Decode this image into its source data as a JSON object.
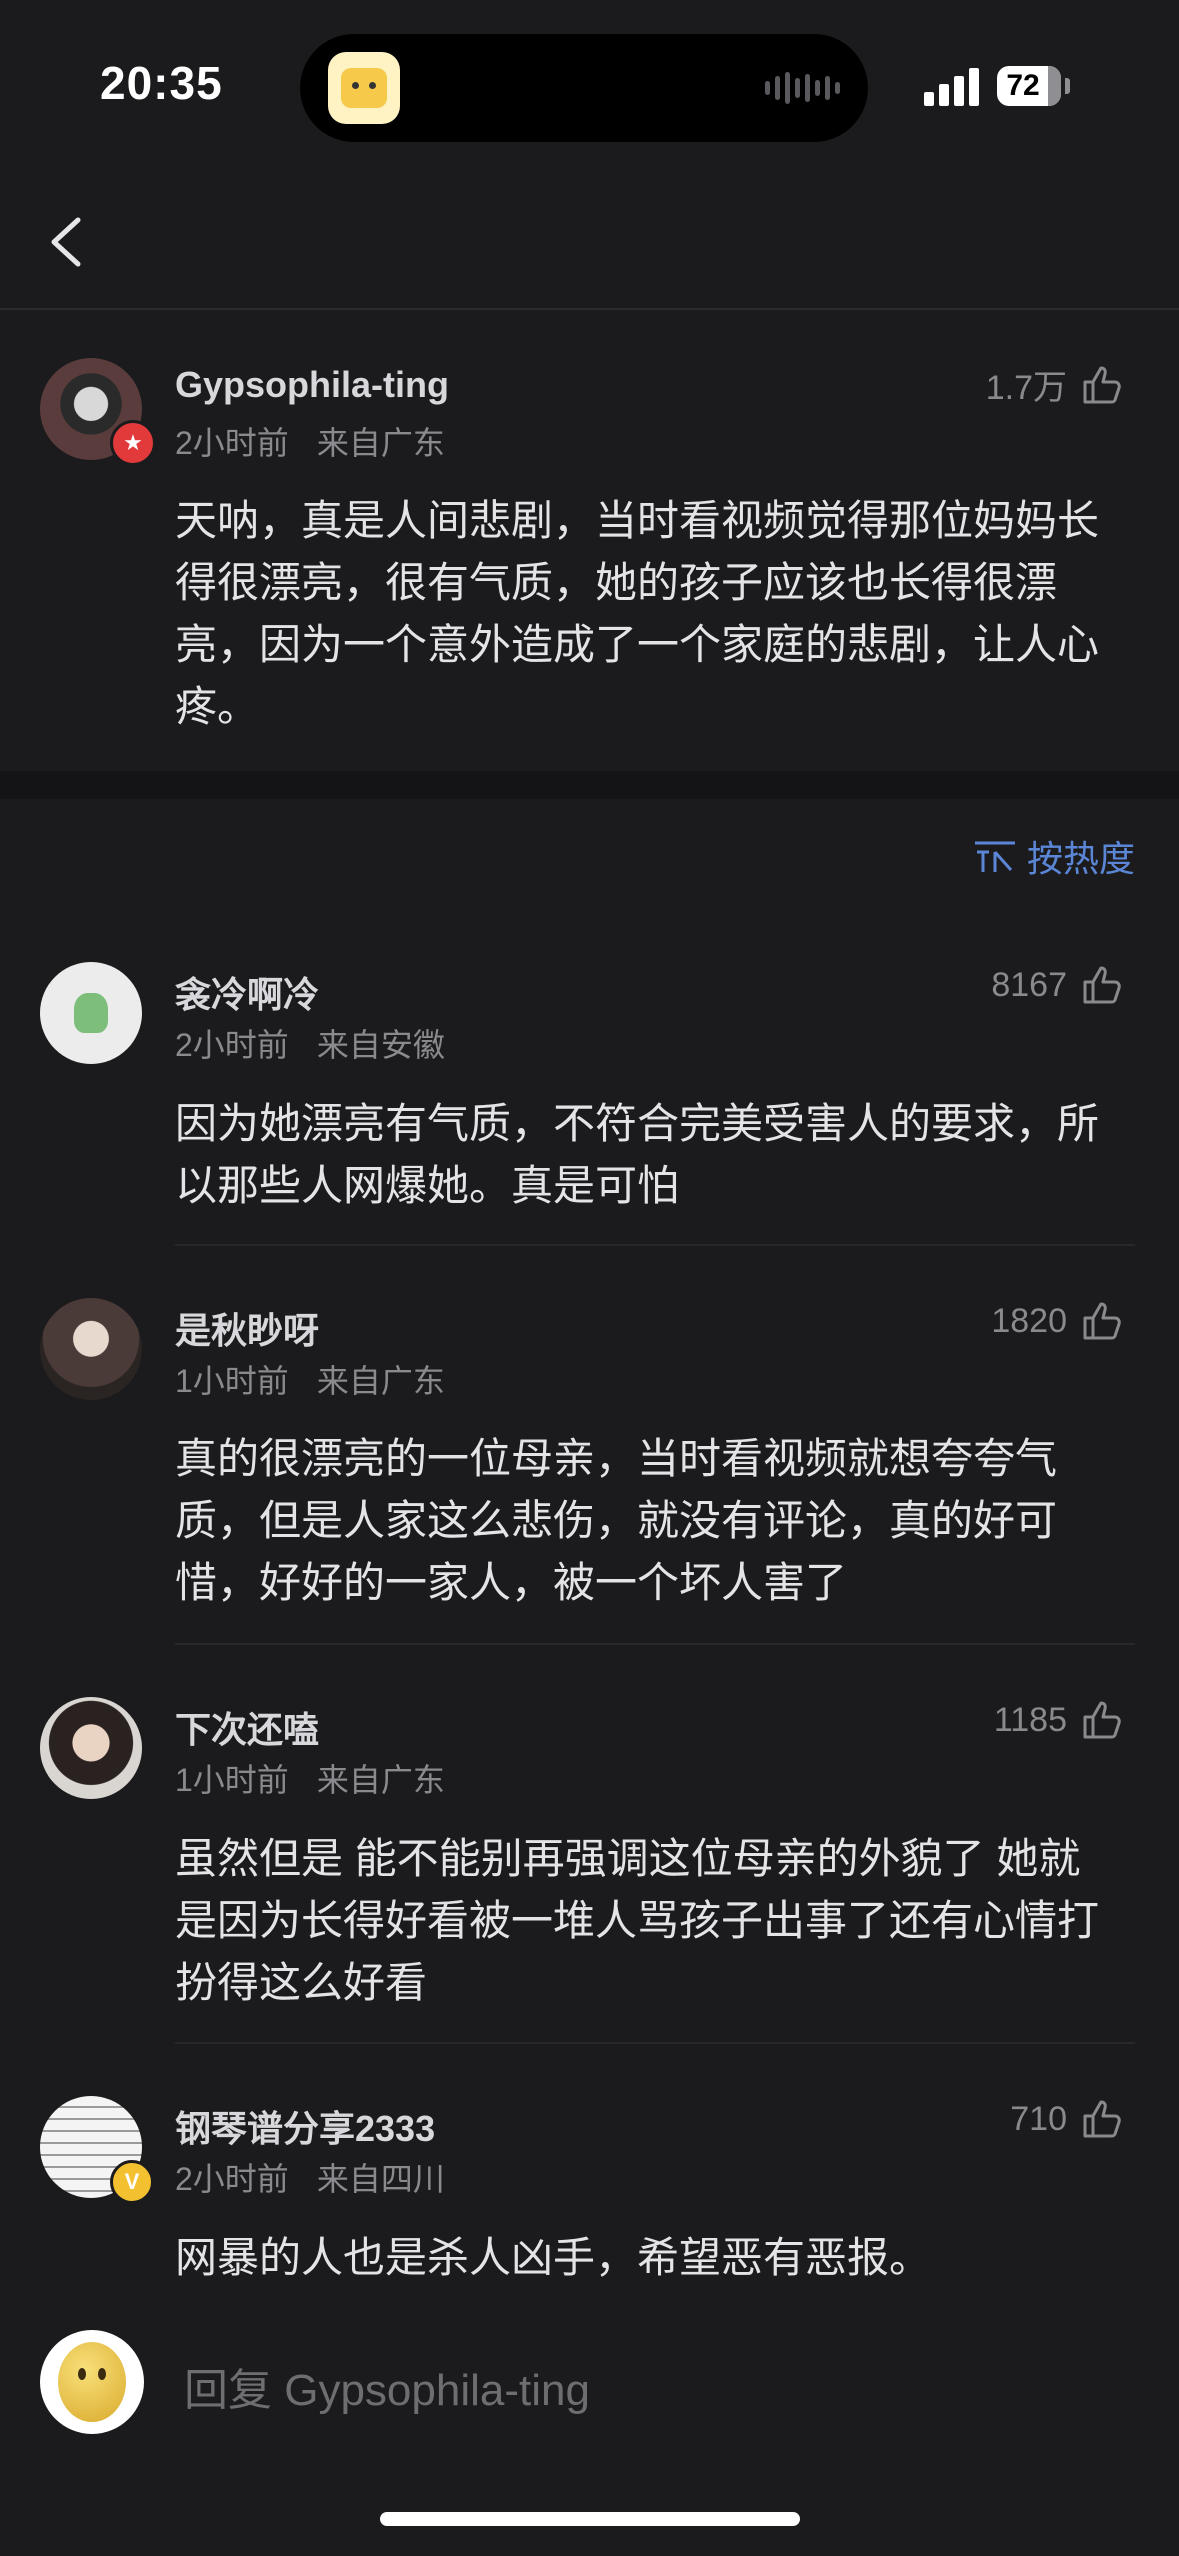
{
  "status_bar": {
    "time": "20:35",
    "battery": "72"
  },
  "main_comment": {
    "username": "Gypsophila-ting",
    "time": "2小时前",
    "location": "来自广东",
    "likes": "1.7万",
    "text": "天呐，真是人间悲剧，当时看视频觉得那位妈妈长得很漂亮，很有气质，她的孩子应该也长得很漂亮，因为一个意外造成了一个家庭的悲剧，让人心疼。"
  },
  "sort": {
    "icon": "sort-lines-icon",
    "label": "按热度"
  },
  "replies": [
    {
      "username": "衾冷啊冷",
      "time": "2小时前",
      "location": "来自安徽",
      "likes": "8167",
      "text": "因为她漂亮有气质，不符合完美受害人的要求，所以那些人网爆她。真是可怕"
    },
    {
      "username": "是秋眇呀",
      "time": "1小时前",
      "location": "来自广东",
      "likes": "1820",
      "text": "真的很漂亮的一位母亲，当时看视频就想夸夸气质，但是人家这么悲伤，就没有评论，真的好可惜，好好的一家人，被一个坏人害了"
    },
    {
      "username": "下次还嗑",
      "time": "1小时前",
      "location": "来自广东",
      "likes": "1185",
      "text": "虽然但是 能不能别再强调这位母亲的外貌了 她就是因为长得好看被一堆人骂孩子出事了还有心情打扮得这么好看"
    },
    {
      "username": "钢琴谱分享2333",
      "time": "2小时前",
      "location": "来自四川",
      "likes": "710",
      "text": "网暴的人也是杀人凶手，希望恶有恶报。"
    }
  ],
  "reply_bar": {
    "placeholder": "回复 Gypsophila-ting"
  },
  "colors": {
    "background": "#1b1b1d",
    "accent": "#5b86d6",
    "muted": "#8a8a8e"
  }
}
